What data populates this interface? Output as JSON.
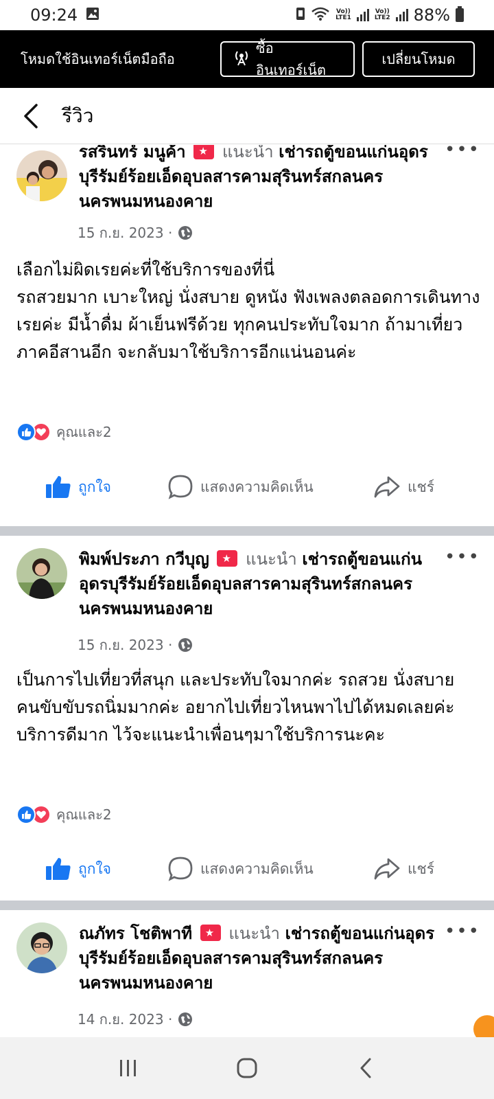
{
  "status_bar": {
    "time": "09:24",
    "volte1": "Vo))",
    "lte1": "LTE1",
    "volte2": "Vo))",
    "lte2": "LTE2",
    "battery": "88%"
  },
  "mode_bar": {
    "text": "โหมดใช้อินเทอร์เน็ตมือถือ",
    "buy_label": "ซื้ออินเทอร์เน็ต",
    "switch_label": "เปลี่ยนโหมด"
  },
  "header": {
    "title": "รีวิว"
  },
  "posts": [
    {
      "name": "รสรินทร์ มนูค้า",
      "recommends": "แนะนำ",
      "page": "เช่ารถตู้ขอนแก่นอุดรบุรีรัมย์ร้อยเอ็ดอุบลสารคามสุรินทร์สกลนครนครพนมหนองคาย",
      "date": "15 ก.ย. 2023 ·",
      "body": "เลือกไม่ผิดเรยค่ะที่ใช้บริการของที่นี่\nรถสวยมาก เบาะใหญ่ นั่งสบาย ดูหนัง ฟังเพลงตลอดการเดินทางเรยค่ะ มีน้ำดื่ม ผ้าเย็นฟรีด้วย ทุกคนประทับใจมาก ถ้ามาเที่ยวภาคอีสานอีก จะกลับมาใช้บริการอีกแน่นอนค่ะ",
      "reactions": "คุณและ2",
      "like_label": "ถูกใจ",
      "comment_label": "แสดงความคิดเห็น",
      "share_label": "แชร์"
    },
    {
      "name": "พิมพ์ประภา กวีบุญ",
      "recommends": "แนะนำ",
      "page": "เช่ารถตู้ขอนแก่นอุดรบุรีรัมย์ร้อยเอ็ดอุบลสารคามสุรินทร์สกลนครนครพนมหนองคาย",
      "date": "15 ก.ย. 2023 ·",
      "body": "เป็นการไปเที่ยวที่สนุก และประทับใจมากค่ะ รถสวย นั่งสบาย คนขับขับรถนิ่มมากค่ะ อยากไปเที่ยวไหนพาไปได้หมดเลยค่ะ บริการดีมาก ไว้จะแนะนำเพื่อนๆมาใช้บริการนะคะ",
      "reactions": "คุณและ2",
      "like_label": "ถูกใจ",
      "comment_label": "แสดงความคิดเห็น",
      "share_label": "แชร์"
    },
    {
      "name": "ณภัทร โชติพาที",
      "recommends": "แนะนำ",
      "page": "เช่ารถตู้ขอนแก่นอุดรบุรีรัมย์ร้อยเอ็ดอุบลสารคามสุรินทร์สกลนครนครพนมหนองคาย",
      "date": "14 ก.ย. 2023 ·"
    }
  ],
  "colors": {
    "accent": "#1877f2",
    "love": "#f33e58",
    "recommend": "#f02849",
    "divider": "#c9ccd1"
  }
}
